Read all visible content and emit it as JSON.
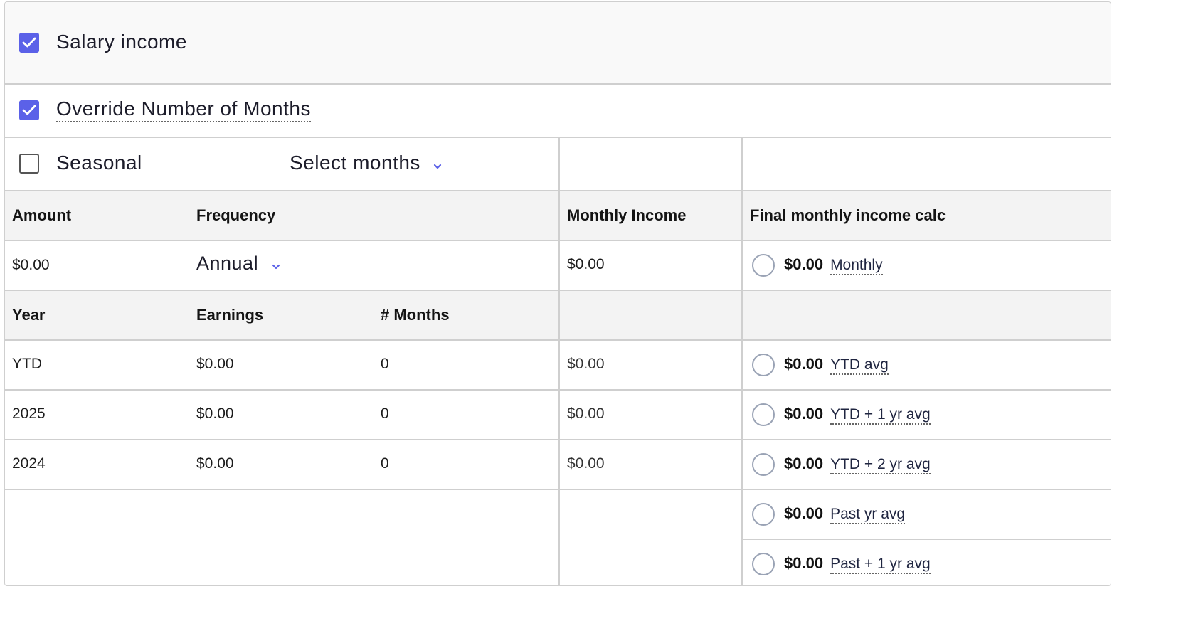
{
  "options": {
    "salary_income": {
      "label": "Salary income",
      "checked": true
    },
    "override_months": {
      "label": "Override Number of Months",
      "checked": true
    },
    "seasonal": {
      "label": "Seasonal",
      "checked": false
    },
    "select_months": {
      "label": "Select months"
    }
  },
  "table": {
    "headers": {
      "amount": "Amount",
      "frequency": "Frequency",
      "monthly_income": "Monthly Income",
      "final_calc": "Final monthly income calc"
    },
    "amount_row": {
      "amount": "$0.00",
      "frequency": "Annual",
      "monthly_income": "$0.00"
    },
    "sub_headers": {
      "year": "Year",
      "earnings": "Earnings",
      "months": "# Months"
    },
    "rows": [
      {
        "year": "YTD",
        "earnings": "$0.00",
        "months": "0",
        "monthly": "$0.00"
      },
      {
        "year": "2025",
        "earnings": "$0.00",
        "months": "0",
        "monthly": "$0.00"
      },
      {
        "year": "2024",
        "earnings": "$0.00",
        "months": "0",
        "monthly": "$0.00"
      }
    ]
  },
  "final_options": [
    {
      "amount": "$0.00",
      "label": "Monthly"
    },
    {
      "amount": "$0.00",
      "label": "YTD avg"
    },
    {
      "amount": "$0.00",
      "label": "YTD + 1 yr avg"
    },
    {
      "amount": "$0.00",
      "label": "YTD + 2 yr avg"
    },
    {
      "amount": "$0.00",
      "label": "Past yr avg"
    },
    {
      "amount": "$0.00",
      "label": "Past + 1 yr avg"
    }
  ],
  "colors": {
    "accent": "#5b61e8",
    "border": "#cfcfcf",
    "header_bg": "#f3f3f3",
    "radio_border": "#9aa3b5"
  },
  "icons": {
    "checkbox_check": "check-icon",
    "dropdown": "chevron-down-icon"
  }
}
